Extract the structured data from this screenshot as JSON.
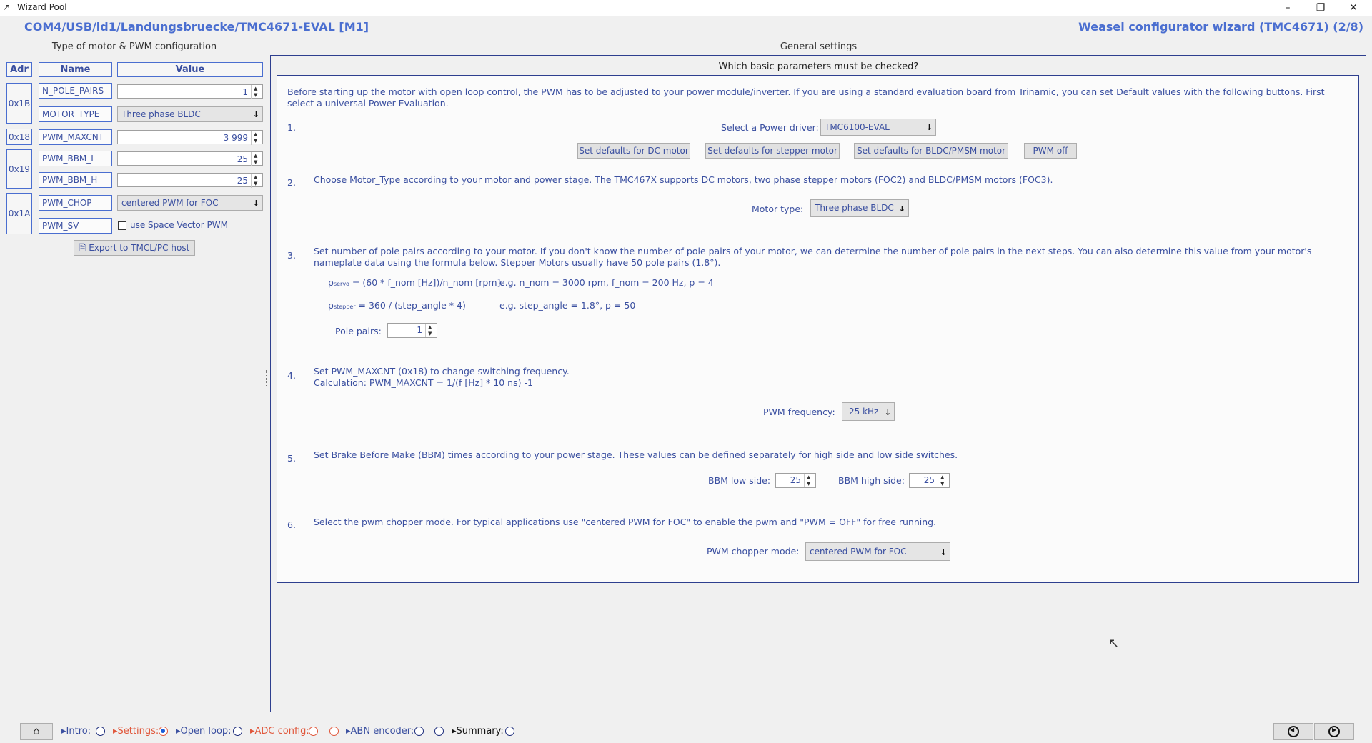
{
  "window": {
    "title": "Wizard Pool",
    "min_icon": "minimize-icon",
    "restore_icon": "restore-icon",
    "close_icon": "close-icon"
  },
  "header": {
    "connection_path": "COM4/USB/id1/Landungsbruecke/TMC4671-EVAL [M1]",
    "wizard_title": "Weasel configurator wizard (TMC4671) (2/8)"
  },
  "left_panel": {
    "caption": "Type of motor &  PWM configuration",
    "headers": {
      "adr": "Adr",
      "name": "Name",
      "value": "Value"
    },
    "addresses": [
      "0x1B",
      "0x18",
      "0x19",
      "0x1A"
    ],
    "rows": [
      {
        "name": "N_POLE_PAIRS",
        "value": "1"
      },
      {
        "name": "MOTOR_TYPE",
        "value": "Three phase BLDC"
      },
      {
        "name": "PWM_MAXCNT",
        "value": "3 999"
      },
      {
        "name": "PWM_BBM_L",
        "value": "25"
      },
      {
        "name": "PWM_BBM_H",
        "value": "25"
      },
      {
        "name": "PWM_CHOP",
        "value": "centered PWM for FOC"
      },
      {
        "name": "PWM_SV",
        "value": "use Space Vector PWM"
      }
    ],
    "export_label": "Export to TMCL/PC host"
  },
  "general": {
    "caption": "General settings",
    "question": "Which basic parameters must be checked?",
    "intro": "Before starting up the motor with open loop control, the PWM has to be adjusted to your power module/inverter. If you are using a standard evaluation board from Trinamic, you can set Default values with the following buttons. First select a universal Power Evaluation.",
    "step1": {
      "num": "1.",
      "power_driver_label": "Select a Power driver:",
      "power_driver_value": "TMC6100-EVAL",
      "btn_dc": "Set defaults for DC motor",
      "btn_stepper": "Set defaults for stepper motor",
      "btn_bldc": "Set defaults for BLDC/PMSM motor",
      "btn_pwm_off": "PWM off"
    },
    "step2": {
      "num": "2.",
      "text": "Choose Motor_Type according to your motor and power stage. The TMC467X supports DC motors, two phase stepper motors (FOC2) and BLDC/PMSM motors (FOC3).",
      "motor_type_label": "Motor type:",
      "motor_type_value": "Three phase BLDC"
    },
    "step3": {
      "num": "3.",
      "text": "Set number of pole pairs according to your motor. If you don't know the number of pole pairs of your motor, we can determine the number of pole pairs in the next steps. You can also determine this value from your motor's nameplate data using the formula below. Stepper Motors usually have 50 pole pairs (1.8°).",
      "p": "p",
      "servo_sub": "servo",
      "servo_formula": " = (60 * f_nom [Hz])/n_nom [rpm]",
      "servo_example": "e.g. n_nom = 3000 rpm, f_nom = 200 Hz, p = 4",
      "stepper_sub": "stepper",
      "stepper_formula": " = 360 / (step_angle * 4)",
      "stepper_example": "e.g. step_angle = 1.8°, p = 50",
      "pole_pairs_label": "Pole pairs:",
      "pole_pairs_value": "1"
    },
    "step4": {
      "num": "4.",
      "text1": "Set PWM_MAXCNT (0x18) to change switching frequency.",
      "text2": "Calculation: PWM_MAXCNT = 1/(f [Hz] * 10 ns) -1",
      "freq_label": "PWM frequency:",
      "freq_value": "25 kHz"
    },
    "step5": {
      "num": "5.",
      "text": "Set Brake Before Make (BBM) times according to your power stage. These values can be defined separately for high side and low side switches.",
      "low_label": "BBM low side:",
      "low_value": "25",
      "high_label": "BBM high side:",
      "high_value": "25"
    },
    "step6": {
      "num": "6.",
      "text": "Select the pwm chopper mode. For typical applications use \"centered PWM for FOC\" to enable the pwm and \"PWM = OFF\" for free running.",
      "chop_label": "PWM chopper mode:",
      "chop_value": "centered PWM for FOC"
    }
  },
  "bottom_nav": {
    "intro": "▸Intro:",
    "settings": "▸Settings:",
    "open_loop": "▸Open loop:",
    "adc_config": "▸ADC config:",
    "abn_encoder": "▸ABN encoder:",
    "summary": "▸Summary:"
  }
}
